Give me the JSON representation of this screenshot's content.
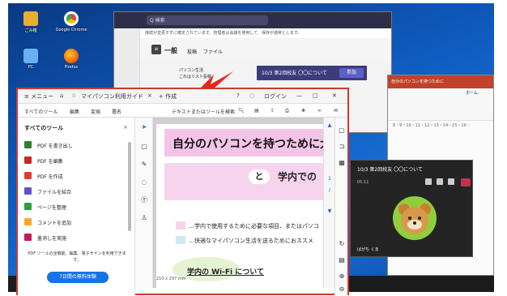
{
  "desktop": {
    "icons": [
      {
        "label": "ごみ箱"
      },
      {
        "label": "Google Chrome"
      },
      {
        "label": "PC"
      },
      {
        "label": "Firefox"
      }
    ]
  },
  "teams": {
    "search_placeholder": "Q 検索",
    "notice": "接続が変更すずに確定されています。管理者は会議を使用して、保存が通常とします。",
    "channel": "一般",
    "tab_posts": "投稿",
    "tab_files": "ファイル",
    "post_author": "パソコン生活",
    "post_text": "これはリスト投稿",
    "meeting_title": "10/3 第2回校友 〇〇について",
    "join_label": "参加"
  },
  "ppt": {
    "title": "自分のパソコンを持つために",
    "tab": "ホーム",
    "ruler": "8・9・10・11・12・13・14・15・16・"
  },
  "call": {
    "title": "10/3 第2回校友 〇〇について",
    "clock": "05:11",
    "name": "ばがち くま"
  },
  "acrobat": {
    "menu_label": "≡ メニュー",
    "tab_title": "マイパソコン利用ガイド",
    "tab_new": "+ 作成",
    "login": "ログイン",
    "toolbar": {
      "all_tools": "すべてのツール",
      "edit": "編集",
      "convert": "変換",
      "sign": "署名",
      "search": "テキストまたはツールを検索"
    },
    "panel": {
      "title": "すべてのツール",
      "tools": [
        {
          "label": "PDF を書き出し",
          "color": "#2e7d32"
        },
        {
          "label": "PDF を編集",
          "color": "#c62828"
        },
        {
          "label": "PDF を作成",
          "color": "#e53935"
        },
        {
          "label": "ファイルを結合",
          "color": "#6a4fbf"
        },
        {
          "label": "ページを整理",
          "color": "#2e9d3e"
        },
        {
          "label": "コメントを追加",
          "color": "#f9a825"
        },
        {
          "label": "墨消しを実施",
          "color": "#c2185b"
        }
      ],
      "footer": "PDF ツールの全機能、編集、電子サインを利用できます。",
      "trial_button": "7日間の無料体験"
    },
    "document": {
      "heading1": "自分のパソコンを持つために大切",
      "and": "と",
      "heading2": "学内での",
      "line1": "…学内で使用するために必要な項目、またはパソコ",
      "line2": "…快適なマイパソコン生活を送るためにおススメ",
      "wifi_title": "学内の Wi-Fi について",
      "page_size": "210 x 297 mm"
    }
  },
  "colors": {
    "acrobat_frame": "#d0382f",
    "adobe_blue": "#1473e6",
    "teams_purple": "#5b5fc7",
    "ppt_red": "#c0412c"
  }
}
